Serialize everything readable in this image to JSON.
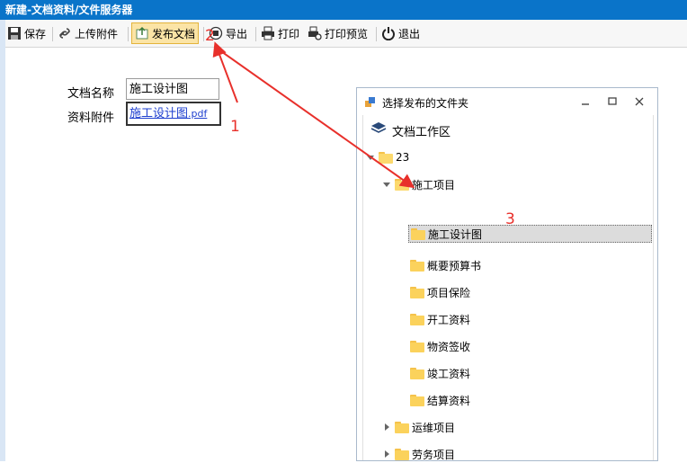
{
  "window": {
    "title": "新建-文档资料/文件服务器"
  },
  "toolbar": {
    "save": "保存",
    "upload": "上传附件",
    "publish": "发布文档",
    "export": "导出",
    "print": "打印",
    "print_preview": "打印预览",
    "exit": "退出"
  },
  "form": {
    "name_label": "文档名称",
    "name_value": "施工设计图",
    "attach_label": "资料附件",
    "attach_link": "施工设计图",
    "attach_ext": ".pdf"
  },
  "dialog": {
    "title": "选择发布的文件夹",
    "root": "文档工作区",
    "tree": {
      "n23": "23",
      "construction": "施工项目",
      "children": [
        "施工设计图",
        "概要预算书",
        "项目保险",
        "开工资料",
        "物资签收",
        "竣工资料",
        "结算资料"
      ],
      "operations": "运维项目",
      "labor": "劳务项目"
    }
  },
  "annotations": {
    "a1": "1",
    "a2": "2",
    "a3": "3"
  },
  "colors": {
    "titlebar": "#0a74c9",
    "annotation": "#e8302b",
    "folder": "#fbd25c",
    "active_button": "#fbe4a6"
  }
}
